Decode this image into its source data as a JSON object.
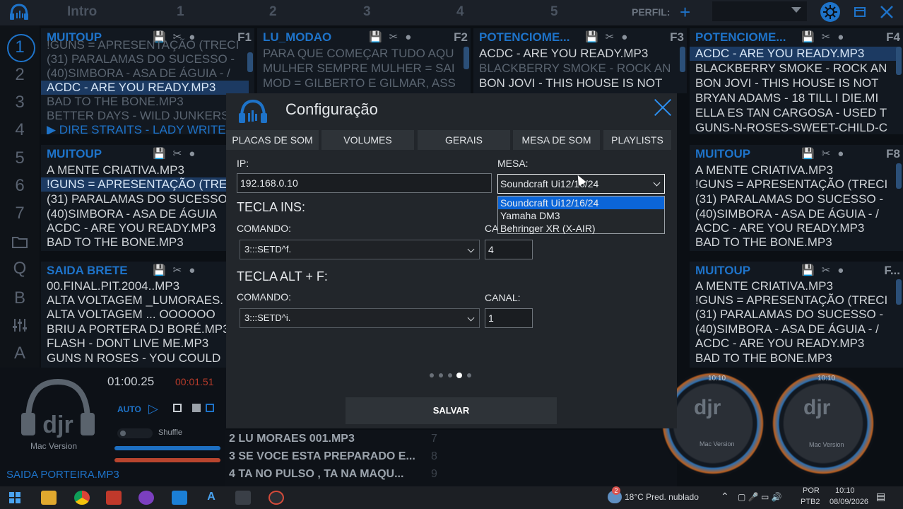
{
  "topbar": {
    "tabs": [
      "Intro",
      "1",
      "2",
      "3",
      "4",
      "5"
    ],
    "perfil_label": "PERFIL:",
    "perfil_value": ""
  },
  "rail": {
    "items": [
      "1",
      "2",
      "3",
      "4",
      "5",
      "6",
      "7",
      "Q",
      "B",
      "A"
    ]
  },
  "panels": [
    {
      "title": "MUITOUP",
      "key": "F1",
      "tracks": [
        "!GUNS = APRESENTAÇÃO (TRECI",
        "(31) PARALAMAS DO SUCESSO -",
        "(40)SIMBORA - ASA DE ÁGUIA - /",
        "ACDC - ARE YOU READY.MP3",
        "BAD TO THE BONE.MP3",
        "BETTER DAYS - WILD JUNKERS.",
        "▶ DIRE STRAITS - LADY WRITER"
      ]
    },
    {
      "title": "LU_MODAO",
      "key": "F2",
      "tracks": [
        "PARA QUE COMEÇAR TUDO AQU",
        "MULHER SEMPRE MULHER = SAI",
        "MOD = GILBERTO E GILMAR, ASS"
      ]
    },
    {
      "title": "POTENCIOME...",
      "key": "F3",
      "tracks": [
        "ACDC - ARE YOU READY.MP3",
        "BLACKBERRY SMOKE - ROCK AN",
        "BON JOVI - THIS HOUSE IS NOT"
      ]
    },
    {
      "title": "POTENCIOME...",
      "key": "F4",
      "tracks": [
        "ACDC - ARE YOU READY.MP3",
        "BLACKBERRY SMOKE - ROCK AN",
        "BON JOVI - THIS HOUSE IS NOT",
        "BRYAN ADAMS - 18 TILL I DIE.MI",
        "ELLA ES TAN CARGOSA - USED T",
        "GUNS-N-ROSES-SWEET-CHILD-C"
      ]
    },
    {
      "title": "MUITOUP",
      "key": "",
      "tracks": [
        "A MENTE CRIATIVA.MP3",
        "!GUNS = APRESENTAÇÃO (TRE",
        "(31) PARALAMAS DO SUCESSO",
        "(40)SIMBORA - ASA DE ÁGUIA",
        "ACDC - ARE YOU READY.MP3",
        "BAD TO THE BONE.MP3"
      ]
    },
    {
      "title": "MUITOUP",
      "key": "F8",
      "tracks": [
        "A MENTE CRIATIVA.MP3",
        "!GUNS = APRESENTAÇÃO (TRECI",
        "(31) PARALAMAS DO SUCESSO -",
        "(40)SIMBORA - ASA DE ÁGUIA - /",
        "ACDC - ARE YOU READY.MP3",
        "BAD TO THE BONE.MP3"
      ]
    },
    {
      "title": "SAIDA BRETE",
      "key": "",
      "tracks": [
        "00.FINAL.PIT.2004..MP3",
        "ALTA VOLTAGEM _LUMORAES.",
        "ALTA VOLTAGEM ... OOOOOO",
        "BRIU A PORTERA DJ BORÉ.MP3",
        "FLASH - DONT LIVE ME.MP3",
        "GUNS N ROSES - YOU COULD"
      ]
    },
    {
      "title": "MUITOUP",
      "key": "F...",
      "tracks": [
        "A MENTE CRIATIVA.MP3",
        "!GUNS = APRESENTAÇÃO (TRECI",
        "(31) PARALAMAS DO SUCESSO -",
        "(40)SIMBORA - ASA DE ÁGUIA - /",
        "ACDC - ARE YOU READY.MP3",
        "BAD TO THE BONE.MP3"
      ]
    }
  ],
  "player": {
    "time": "01:00.25",
    "remaining": "00:01.51",
    "auto_label": "AUTO",
    "shuffle_label": "Shuffle",
    "mac_version": "Mac Version",
    "now_playing": "SAIDA PORTEIRA.MP3"
  },
  "queue": [
    {
      "num": "2",
      "title": "LU MORAES 001.MP3",
      "next": "7"
    },
    {
      "num": "3",
      "title": "SE VOCE ESTA PREPARADO E...",
      "next": "8"
    },
    {
      "num": "4",
      "title": "TA NO PULSO , TA NA MAQU...",
      "next": "9"
    }
  ],
  "decks": [
    {
      "time": "10:10",
      "label": "Mac Version"
    },
    {
      "time": "10:10",
      "label": "Mac Version"
    }
  ],
  "modal": {
    "title": "Configuração",
    "tabs": [
      "PLACAS DE SOM",
      "VOLUMES",
      "GERAIS",
      "MESA DE SOM",
      "PLAYLISTS"
    ],
    "ip_label": "IP:",
    "ip_value": "192.168.0.10",
    "mesa_label": "MESA:",
    "mesa_value": "Soundcraft Ui12/16/24",
    "mesa_options": [
      "Soundcraft Ui12/16/24",
      "Yamaha DM3",
      "Behringer XR (X-AIR)"
    ],
    "tecla_ins": {
      "heading": "TECLA INS:",
      "comando_label": "COMANDO:",
      "comando_value": "3:::SETD^f.",
      "canal_label": "CA",
      "canal_value": "4"
    },
    "tecla_alt": {
      "heading": "TECLA ALT + F:",
      "comando_label": "COMANDO:",
      "comando_value": "3:::SETD^i.",
      "canal_label": "CANAL:",
      "canal_value": "1"
    },
    "page_index": 4,
    "page_count": 5,
    "save_label": "SALVAR"
  },
  "taskbar": {
    "weather": "18°C  Pred. nublado",
    "lang_top": "POR",
    "lang_bottom": "PTB2",
    "clock_time": "10:10",
    "clock_date": "08/09/2026",
    "badge": "2"
  },
  "colors": {
    "accent": "#1e73c9",
    "selection": "#0b65d8",
    "modal_bg": "#22262b"
  }
}
